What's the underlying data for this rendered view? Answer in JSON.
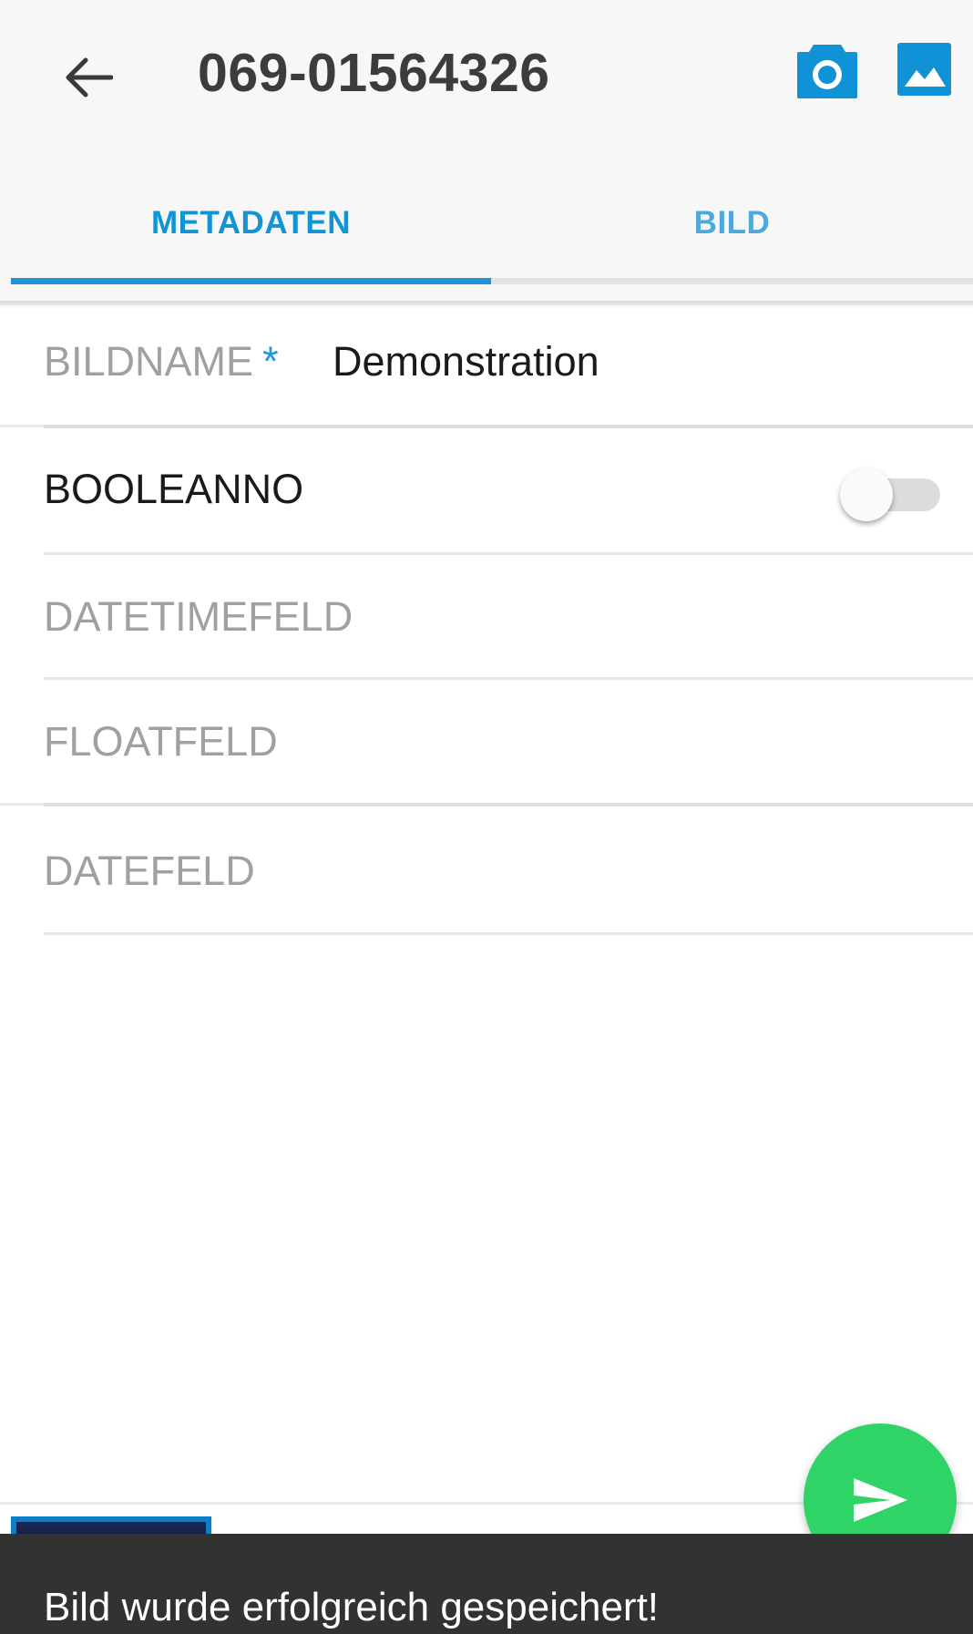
{
  "appbar": {
    "title": "069-01564326",
    "back_icon": "arrow-left-icon",
    "camera_icon": "camera-icon",
    "gallery_icon": "image-icon",
    "accent": "#1092d6"
  },
  "tabs": [
    {
      "label": "METADATEN",
      "active": true
    },
    {
      "label": "BILD",
      "active": false
    }
  ],
  "form": {
    "bildname": {
      "label": "BILDNAME",
      "required_mark": "*",
      "value": "Demonstration"
    },
    "booleanno": {
      "label": "BOOLEANNO",
      "checked": false
    },
    "datetimefeld": {
      "label": "DATETIMEFELD"
    },
    "floatfeld": {
      "label": "FLOATFELD"
    },
    "datefeld": {
      "label": "DATEFELD"
    }
  },
  "fab": {
    "icon": "send-icon",
    "color": "#2fd366"
  },
  "snackbar": {
    "message": "Bild wurde erfolgreich gespeichert!"
  }
}
